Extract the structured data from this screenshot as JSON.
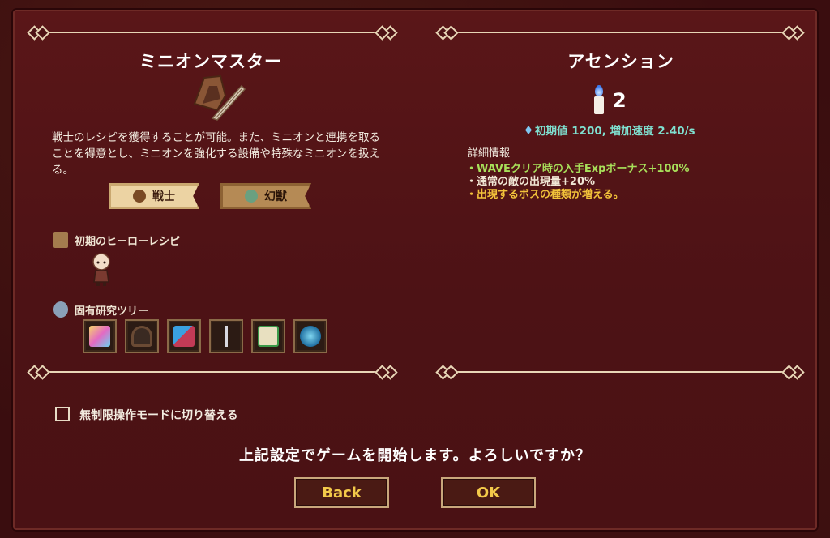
{
  "left": {
    "title": "ミニオンマスター",
    "description": "戦士のレシピを獲得することが可能。また、ミニオンと連携を取ることを得意とし、ミニオンを強化する設備や特殊なミニオンを扱える。",
    "tabs": [
      {
        "label": "戦士",
        "state": "active"
      },
      {
        "label": "幻獣",
        "state": "inactive"
      }
    ],
    "hero_recipe_label": "初期のヒーローレシピ",
    "research_tree_label": "固有研究ツリー"
  },
  "right": {
    "title": "アセンション",
    "level": "2",
    "initial": "初期値 1200, 増加速度 2.40/s",
    "details_label": "詳細情報",
    "details": [
      {
        "text": "・WAVEクリア時の入手Expボーナス+100%",
        "color": "#a8e05a"
      },
      {
        "text": "・通常の敵の出現量+20%",
        "color": "#f0e6d4"
      },
      {
        "text": "・出現するボスの種類が増える。",
        "color": "#f2c23a"
      }
    ]
  },
  "unlimited_mode_label": "無制限操作モードに切り替える",
  "confirm_text": "上記設定でゲームを開始します。よろしいですか？",
  "buttons": {
    "back": "Back",
    "ok": "OK"
  }
}
